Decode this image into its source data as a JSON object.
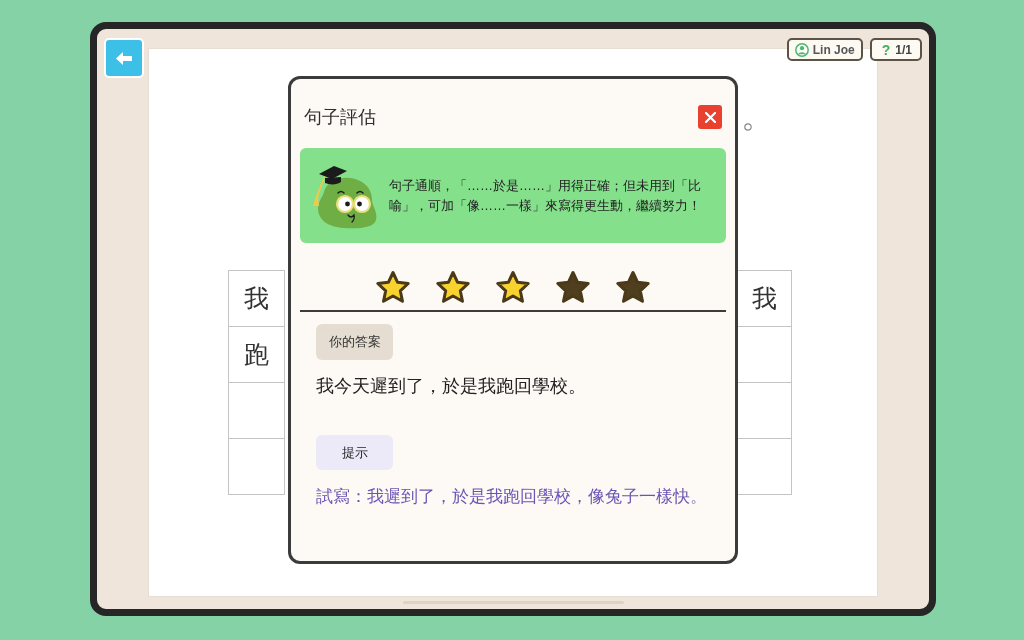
{
  "toolbar": {
    "user_name": "Lin Joe",
    "progress": {
      "mark": "?",
      "count": "1/1"
    }
  },
  "worksheet": {
    "grid": {
      "left_column": [
        "我",
        "跑"
      ],
      "right_column": [
        "我"
      ]
    }
  },
  "dialog": {
    "title": "句子評估",
    "feedback": "句子通順，「……於是……」用得正確；但未用到「比喻」，可加「像……一樣」來寫得更生動，繼續努力！",
    "stars": 3,
    "answer": {
      "label": "你的答案",
      "text": "我今天遲到了，於是我跑回學校。"
    },
    "hint": {
      "label": "提示",
      "text": "試寫：我遲到了，於是我跑回學校，像兔子一樣快。"
    }
  }
}
